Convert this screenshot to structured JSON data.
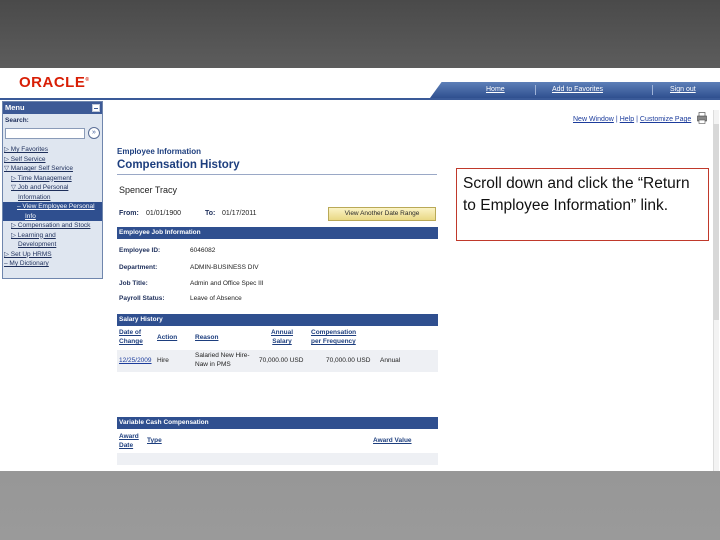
{
  "header": {
    "logo": "ORACLE",
    "nav": [
      "Home",
      "Add to Favorites",
      "Sign out"
    ]
  },
  "menu": {
    "title": "Menu",
    "search_label": "Search:",
    "items": [
      "▷ My Favorites",
      "▷ Self Service",
      "▽ Manager Self Service",
      "▷ Time Management",
      "▽ Job and Personal",
      "Information",
      "– View Employee Personal",
      "Info",
      "▷ Compensation and Stock",
      "▷ Learning and",
      "Development",
      "▷ Set Up HRMS",
      "– My Dictionary"
    ]
  },
  "toplinks": [
    "New Window",
    "Help",
    "Customize Page"
  ],
  "page": {
    "breadcrumb": "Employee Information",
    "title": "Compensation History",
    "employee_name": "Spencer Tracy",
    "from_label": "From:",
    "from_value": "01/01/1900",
    "to_label": "To:",
    "to_value": "01/17/2011",
    "range_button": "View Another Date Range"
  },
  "job_info": {
    "section_title": "Employee Job Information",
    "fields": [
      {
        "label": "Employee ID:",
        "value": "6046082"
      },
      {
        "label": "Department:",
        "value": "ADMIN-BUSINESS DIV"
      },
      {
        "label": "Job Title:",
        "value": "Admin and Office Spec III"
      },
      {
        "label": "Payroll Status:",
        "value": "Leave of Absence"
      }
    ]
  },
  "salary_history": {
    "section_title": "Salary History",
    "headers": [
      "Date of Change",
      "Action",
      "Reason",
      "Annual Salary",
      "Compensation per Frequency"
    ],
    "row": {
      "date": "12/25/2009",
      "action": "Hire",
      "reason": "Salaried New Hire-Naw in PMS",
      "annual": "70,000.00 USD",
      "comp": "70,000.00 USD",
      "freq": "Annual"
    }
  },
  "variable_cash": {
    "section_title": "Variable Cash Compensation",
    "headers": [
      "Award Date",
      "Type",
      "Award Value"
    ]
  },
  "callout": {
    "text": "Scroll down and click the “Return to Employee Information” link."
  },
  "colors": {
    "oracle_red": "#d81e05",
    "nav_blue": "#2f4f8f",
    "link_blue": "#1c3c9c",
    "callout_border": "#c0392b"
  }
}
